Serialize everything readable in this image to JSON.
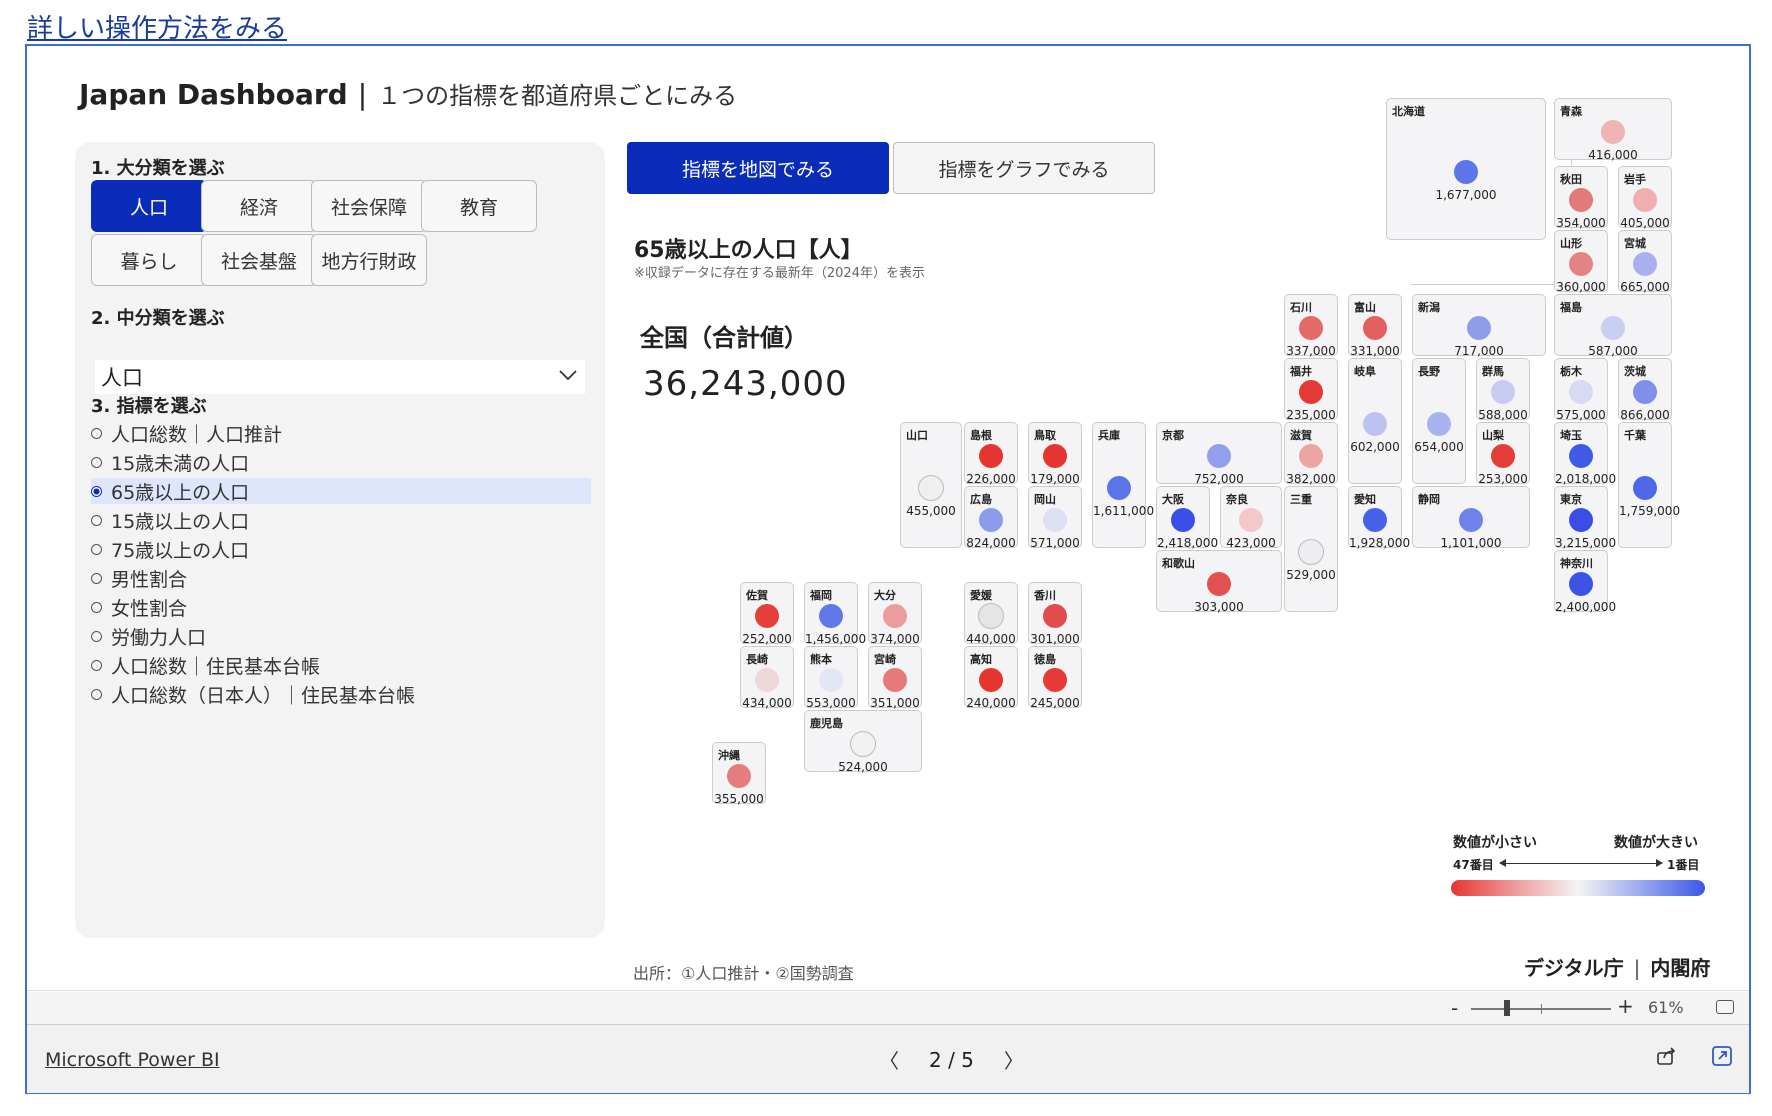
{
  "link": {
    "howto": "詳しい操作方法をみる"
  },
  "header": {
    "title": "Japan Dashboard",
    "separator": "|",
    "subtitle": "１つの指標を都道府県ごとにみる"
  },
  "step1": {
    "label": "1. 大分類を選ぶ",
    "categories": [
      "人口",
      "経済",
      "社会保障",
      "教育",
      "暮らし",
      "社会基盤",
      "地方行財政"
    ],
    "selected": "人口"
  },
  "step2": {
    "label": "2. 中分類を選ぶ",
    "selected": "人口"
  },
  "step3": {
    "label": "3. 指標を選ぶ",
    "options": [
      "人口総数｜人口推計",
      "15歳未満の人口",
      "65歳以上の人口",
      "15歳以上の人口",
      "75歳以上の人口",
      "男性割合",
      "女性割合",
      "労働力人口",
      "人口総数｜住民基本台帳",
      "人口総数（日本人）｜住民基本台帳"
    ],
    "selected_index": 2
  },
  "tabs": {
    "map": "指標を地図でみる",
    "graph": "指標をグラフでみる"
  },
  "indicator": {
    "title": "65歳以上の人口【人】",
    "note": "※収録データに存在する最新年（2024年）を表示"
  },
  "national": {
    "label": "全国（合計値）",
    "value": "36,243,000"
  },
  "prefectures": [
    {
      "name": "北海道",
      "value": "1,677,000",
      "color": "#5a76e8"
    },
    {
      "name": "青森",
      "value": "416,000",
      "color": "#efb5b5"
    },
    {
      "name": "秋田",
      "value": "354,000",
      "color": "#e27a7a"
    },
    {
      "name": "岩手",
      "value": "405,000",
      "color": "#f0aeae"
    },
    {
      "name": "山形",
      "value": "360,000",
      "color": "#e38383"
    },
    {
      "name": "宮城",
      "value": "665,000",
      "color": "#a8b1ee"
    },
    {
      "name": "石川",
      "value": "337,000",
      "color": "#e46a6a"
    },
    {
      "name": "富山",
      "value": "331,000",
      "color": "#e45f5f"
    },
    {
      "name": "新潟",
      "value": "717,000",
      "color": "#8f9eec"
    },
    {
      "name": "福島",
      "value": "587,000",
      "color": "#c9cff2"
    },
    {
      "name": "福井",
      "value": "235,000",
      "color": "#e43a35"
    },
    {
      "name": "岐阜",
      "value": "602,000",
      "color": "#bcc3f0"
    },
    {
      "name": "長野",
      "value": "654,000",
      "color": "#a9b3ee"
    },
    {
      "name": "群馬",
      "value": "588,000",
      "color": "#c6ccf1"
    },
    {
      "name": "栃木",
      "value": "575,000",
      "color": "#d6daf3"
    },
    {
      "name": "茨城",
      "value": "866,000",
      "color": "#7f8fea"
    },
    {
      "name": "山口",
      "value": "455,000",
      "color": "#efefef"
    },
    {
      "name": "島根",
      "value": "226,000",
      "color": "#e53530"
    },
    {
      "name": "鳥取",
      "value": "179,000",
      "color": "#e53530"
    },
    {
      "name": "兵庫",
      "value": "1,611,000",
      "color": "#5b74e8"
    },
    {
      "name": "京都",
      "value": "752,000",
      "color": "#919fec"
    },
    {
      "name": "滋賀",
      "value": "382,000",
      "color": "#eca5a5"
    },
    {
      "name": "山梨",
      "value": "253,000",
      "color": "#e43e38"
    },
    {
      "name": "埼玉",
      "value": "2,018,000",
      "color": "#3f5ae6"
    },
    {
      "name": "千葉",
      "value": "1,759,000",
      "color": "#4e68e7"
    },
    {
      "name": "広島",
      "value": "824,000",
      "color": "#8d9bec"
    },
    {
      "name": "岡山",
      "value": "571,000",
      "color": "#dde0f3"
    },
    {
      "name": "大阪",
      "value": "2,418,000",
      "color": "#3b4fe8"
    },
    {
      "name": "奈良",
      "value": "423,000",
      "color": "#f2c8c8"
    },
    {
      "name": "三重",
      "value": "529,000",
      "color": "#eeeef2"
    },
    {
      "name": "愛知",
      "value": "1,928,000",
      "color": "#4661e6"
    },
    {
      "name": "静岡",
      "value": "1,101,000",
      "color": "#6f82e9"
    },
    {
      "name": "東京",
      "value": "3,215,000",
      "color": "#3a4ee6"
    },
    {
      "name": "和歌山",
      "value": "303,000",
      "color": "#e35050"
    },
    {
      "name": "神奈川",
      "value": "2,400,000",
      "color": "#3b53e6"
    },
    {
      "name": "佐賀",
      "value": "252,000",
      "color": "#e53f3a"
    },
    {
      "name": "福岡",
      "value": "1,456,000",
      "color": "#6178e8"
    },
    {
      "name": "大分",
      "value": "374,000",
      "color": "#eb9c9c"
    },
    {
      "name": "愛媛",
      "value": "440,000",
      "color": "#e5e5e5"
    },
    {
      "name": "香川",
      "value": "301,000",
      "color": "#e34c4c"
    },
    {
      "name": "長崎",
      "value": "434,000",
      "color": "#efd8d8"
    },
    {
      "name": "熊本",
      "value": "553,000",
      "color": "#e2e6f5"
    },
    {
      "name": "宮崎",
      "value": "351,000",
      "color": "#e67a7a"
    },
    {
      "name": "高知",
      "value": "240,000",
      "color": "#e5352f"
    },
    {
      "name": "徳島",
      "value": "245,000",
      "color": "#e53a35"
    },
    {
      "name": "鹿児島",
      "value": "524,000",
      "color": "#f2f2f2"
    },
    {
      "name": "沖縄",
      "value": "355,000",
      "color": "#e47e7e"
    }
  ],
  "legend": {
    "small": "数値が小さい",
    "large": "数値が大きい",
    "rank_low": "47番目",
    "rank_high": "1番目"
  },
  "source": "出所：①人口推計・②国勢調査",
  "org": {
    "a": "デジタル庁",
    "sep": "|",
    "b": "内閣府"
  },
  "zoom": {
    "minus": "-",
    "plus": "+",
    "percent": "61%"
  },
  "footer": {
    "brand": "Microsoft Power BI",
    "page": "2 / 5",
    "prev": "〈",
    "next": "〉"
  }
}
